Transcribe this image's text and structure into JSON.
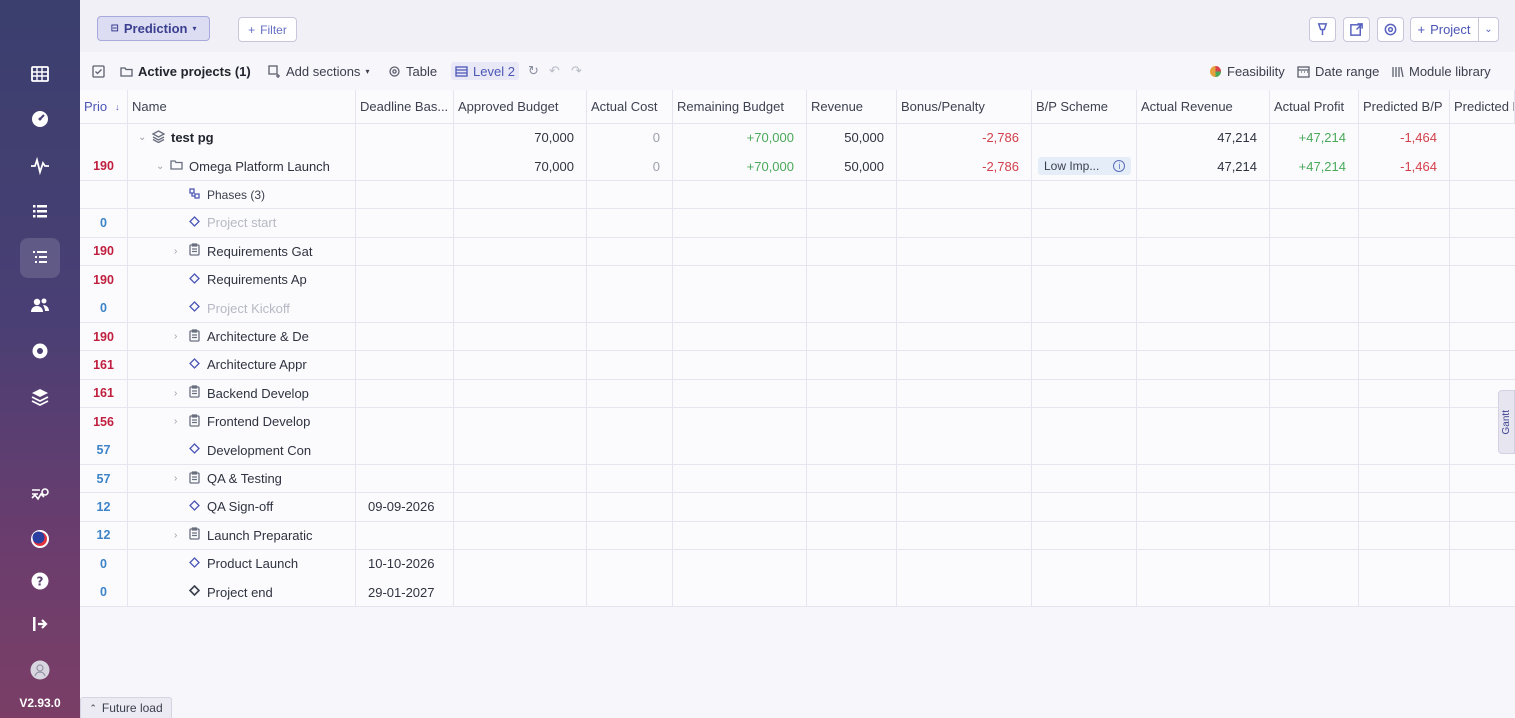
{
  "app": {
    "version": "V2.93.0"
  },
  "sidebar": {
    "icons": [
      "grid-icon",
      "dashboard-icon",
      "pulse-icon",
      "list-icon",
      "tasks-icon",
      "users-icon",
      "settings-icon",
      "layers-icon",
      "analytics-icon",
      "brand-icon",
      "help-icon",
      "logout-icon",
      "avatar-icon"
    ]
  },
  "topbar": {
    "prediction_label": "Prediction",
    "filter_label": "Filter",
    "project_label": "Project"
  },
  "toolbar": {
    "active_projects": "Active projects (1)",
    "add_sections": "Add sections",
    "table": "Table",
    "level": "Level 2",
    "feasibility": "Feasibility",
    "date_range": "Date range",
    "module_library": "Module library"
  },
  "columns": [
    "Prio",
    "Name",
    "Deadline Bas...",
    "Approved Budget",
    "Actual Cost",
    "Remaining Budget",
    "Revenue",
    "Bonus/Penalty",
    "B/P Scheme",
    "Actual Revenue",
    "Actual Profit",
    "Predicted B/P",
    "Predicted R"
  ],
  "rows": [
    {
      "prio": "",
      "prio_color": "",
      "name": "test pg",
      "indent": 1,
      "icon": "stack",
      "caret": "⌄",
      "bold": true,
      "deadline": "",
      "approved": "70,000",
      "cost": "0",
      "remaining": "+70,000",
      "revenue": "50,000",
      "bonus": "-2,786",
      "scheme": "",
      "actual_revenue": "47,214",
      "actual_profit": "+47,214",
      "predicted_bp": "-1,464"
    },
    {
      "prio": "190",
      "prio_color": "red",
      "name": "Omega Platform Launch",
      "indent": 2,
      "icon": "folder",
      "caret": "⌄",
      "bold": false,
      "deadline": "",
      "approved": "70,000",
      "cost": "0",
      "remaining": "+70,000",
      "revenue": "50,000",
      "bonus": "-2,786",
      "scheme": "Low Imp...",
      "actual_revenue": "47,214",
      "actual_profit": "+47,214",
      "predicted_bp": "-1,464"
    },
    {
      "prio": "",
      "prio_color": "",
      "name": "Phases (3)",
      "indent": 3,
      "icon": "phases",
      "caret": "",
      "bold": false,
      "small": true,
      "deadline": ""
    },
    {
      "prio": "0",
      "prio_color": "blue",
      "name": "Project start",
      "indent": 3,
      "icon": "diamond",
      "caret": "",
      "dim": true,
      "deadline": ""
    },
    {
      "prio": "190",
      "prio_color": "red",
      "name": "Requirements Gat",
      "indent": 3,
      "icon": "clipboard",
      "caret": "›",
      "deadline": ""
    },
    {
      "prio": "190",
      "prio_color": "red",
      "name": "Requirements Ap",
      "indent": 3,
      "icon": "diamond",
      "caret": "",
      "deadline": ""
    },
    {
      "prio": "0",
      "prio_color": "blue",
      "name": "Project Kickoff",
      "indent": 3,
      "icon": "diamond",
      "caret": "",
      "dim": true,
      "deadline": ""
    },
    {
      "prio": "190",
      "prio_color": "red",
      "name": "Architecture & De",
      "indent": 3,
      "icon": "clipboard",
      "caret": "›",
      "deadline": ""
    },
    {
      "prio": "161",
      "prio_color": "red",
      "name": "Architecture Appr",
      "indent": 3,
      "icon": "diamond",
      "caret": "",
      "deadline": ""
    },
    {
      "prio": "161",
      "prio_color": "red",
      "name": "Backend Develop",
      "indent": 3,
      "icon": "clipboard",
      "caret": "›",
      "deadline": ""
    },
    {
      "prio": "156",
      "prio_color": "red",
      "name": "Frontend Develop",
      "indent": 3,
      "icon": "clipboard",
      "caret": "›",
      "deadline": ""
    },
    {
      "prio": "57",
      "prio_color": "blue",
      "name": "Development Con",
      "indent": 3,
      "icon": "diamond",
      "caret": "",
      "deadline": ""
    },
    {
      "prio": "57",
      "prio_color": "blue",
      "name": "QA & Testing",
      "indent": 3,
      "icon": "clipboard",
      "caret": "›",
      "deadline": ""
    },
    {
      "prio": "12",
      "prio_color": "blue",
      "name": "QA Sign-off",
      "indent": 3,
      "icon": "diamond",
      "caret": "",
      "deadline": "09-09-2026"
    },
    {
      "prio": "12",
      "prio_color": "blue",
      "name": "Launch Preparatic",
      "indent": 3,
      "icon": "clipboard",
      "caret": "›",
      "deadline": ""
    },
    {
      "prio": "0",
      "prio_color": "blue",
      "name": "Product Launch",
      "indent": 3,
      "icon": "diamond",
      "caret": "",
      "deadline": "10-10-2026"
    },
    {
      "prio": "0",
      "prio_color": "blue",
      "name": "Project end",
      "indent": 3,
      "icon": "diamond-solid",
      "caret": "",
      "deadline": "29-01-2027"
    }
  ],
  "gantt_tab": "Gantt",
  "future_load": "Future load"
}
